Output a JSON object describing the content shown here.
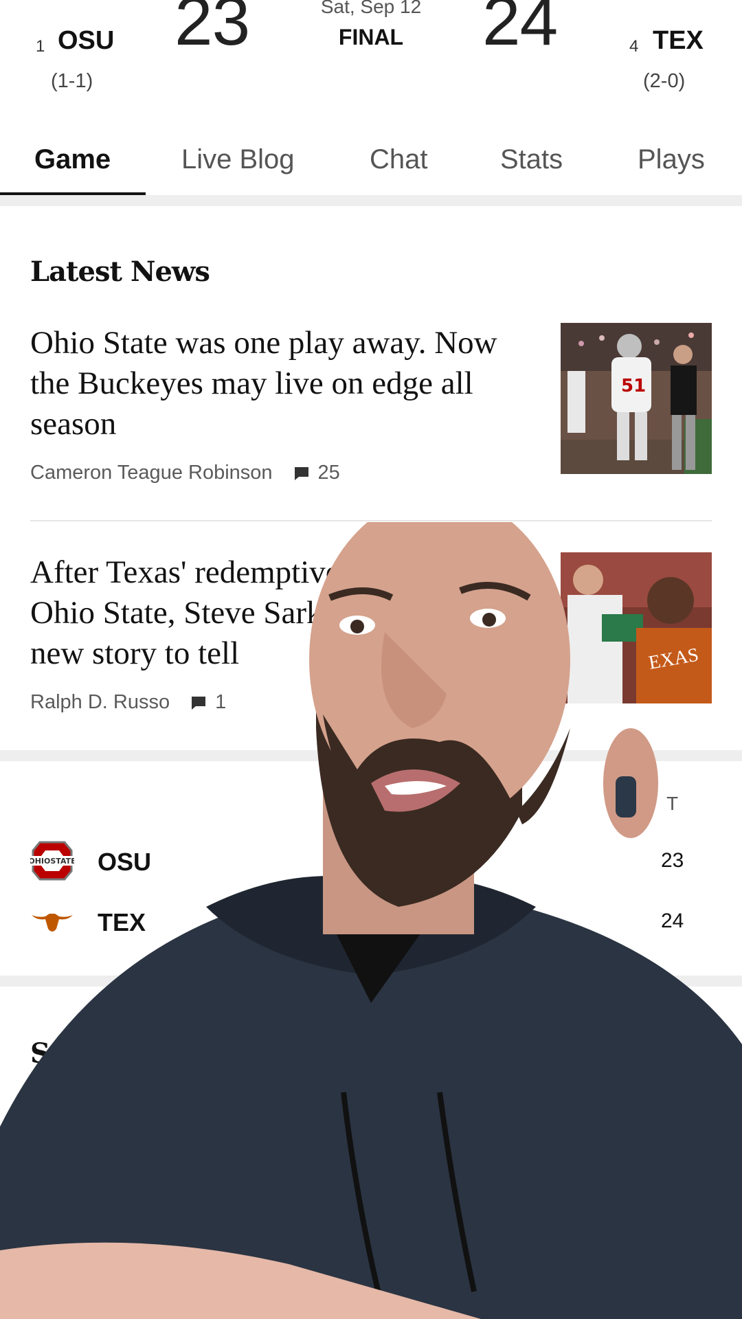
{
  "scoreboard": {
    "home": {
      "rank": "1",
      "abbr": "OSU",
      "record": "(1-1)",
      "score": "23",
      "logo": "ohio-state-logo"
    },
    "away": {
      "rank": "4",
      "abbr": "TEX",
      "record": "(2-0)",
      "score": "24",
      "logo": "texas-longhorn-logo"
    },
    "date": "Sat, Sep 12",
    "status": "FINAL"
  },
  "tabs": [
    {
      "label": "Game",
      "active": true
    },
    {
      "label": "Live Blog",
      "active": false
    },
    {
      "label": "Chat",
      "active": false
    },
    {
      "label": "Stats",
      "active": false
    },
    {
      "label": "Plays",
      "active": false
    }
  ],
  "latest_news": {
    "title": "Latest News",
    "articles": [
      {
        "headline_lines": [
          "Ohio State was one play away. Now",
          "the Buckeyes may live on edge all",
          "season"
        ],
        "author": "Cameron Teague Robinson",
        "comments": "25",
        "thumbnail": "ohio-state-players-photo"
      },
      {
        "headline_lines": [
          "After Texas' redemptive rally",
          "Ohio State, Steve Sarkisian",
          "new story to tell"
        ],
        "author": "Ralph D. Russo",
        "comments": "1",
        "thumbnail": "texas-celebration-photo"
      }
    ]
  },
  "line_score": {
    "total_header": "T",
    "rows": [
      {
        "team": "OSU",
        "total": "23",
        "logo": "ohio-state-logo"
      },
      {
        "team": "TEX",
        "total": "24",
        "logo": "texas-longhorn-logo"
      }
    ]
  },
  "partial_heading": "S",
  "colors": {
    "osu_scarlet": "#bb0000",
    "texas_orange": "#bf5700",
    "text": "#121212",
    "muted": "#5a5a5a",
    "divider": "#eeeeee"
  }
}
